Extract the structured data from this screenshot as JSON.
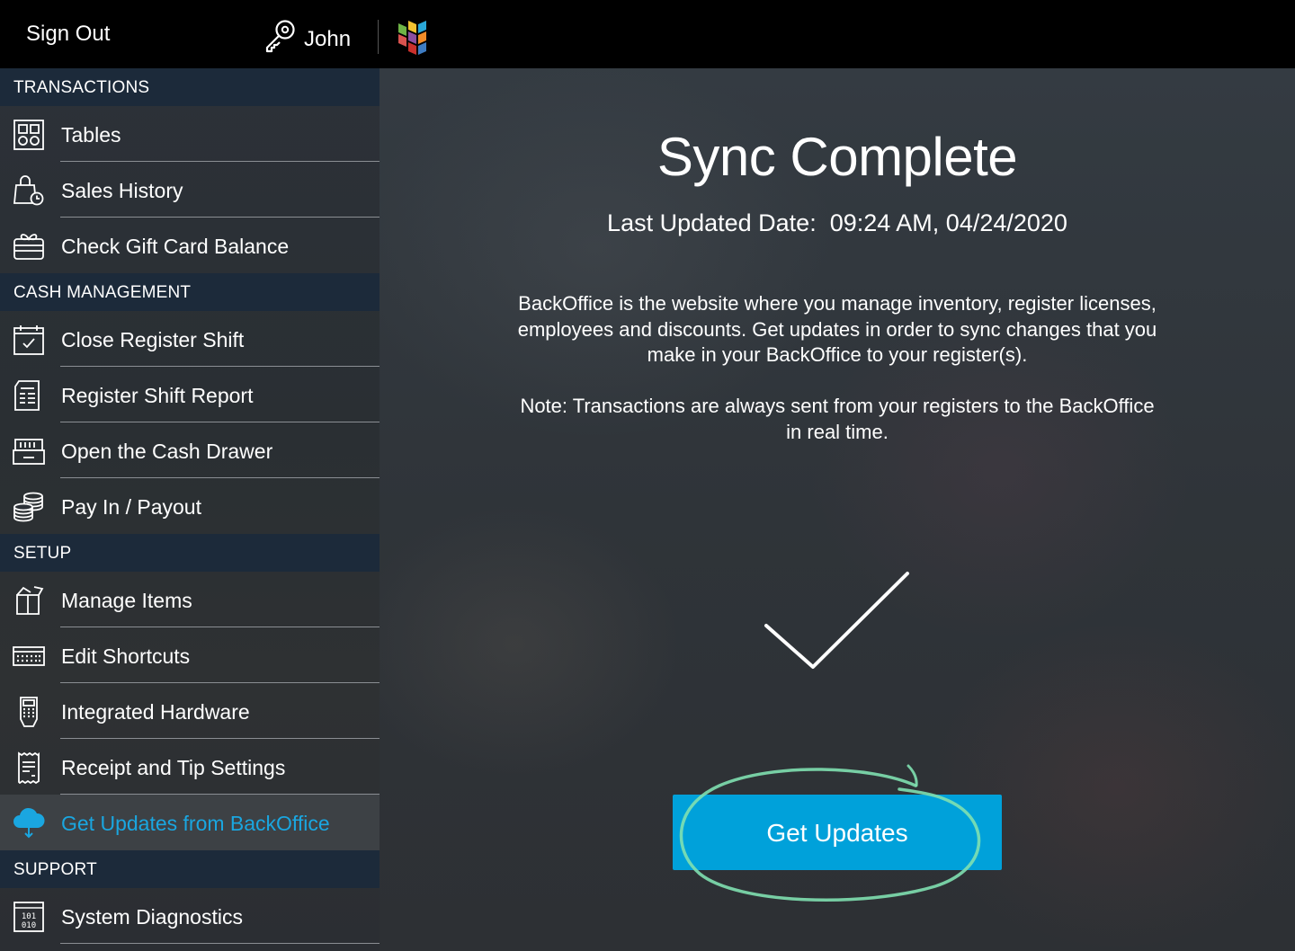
{
  "topbar": {
    "sign_out": "Sign Out",
    "user_name": "John",
    "icons": {
      "user": "key-icon",
      "logo": "brand-logo-icon"
    }
  },
  "sidebar": {
    "sections": [
      {
        "header": "TRANSACTIONS",
        "items": [
          {
            "label": "Tables",
            "icon": "tables-icon"
          },
          {
            "label": "Sales History",
            "icon": "shopping-bag-clock-icon"
          },
          {
            "label": "Check Gift Card Balance",
            "icon": "gift-card-icon"
          }
        ]
      },
      {
        "header": "CASH MANAGEMENT",
        "items": [
          {
            "label": "Close Register Shift",
            "icon": "calendar-check-icon"
          },
          {
            "label": "Register Shift Report",
            "icon": "report-icon"
          },
          {
            "label": "Open the Cash Drawer",
            "icon": "cash-drawer-icon"
          },
          {
            "label": "Pay In / Payout",
            "icon": "coins-icon"
          }
        ]
      },
      {
        "header": "SETUP",
        "items": [
          {
            "label": "Manage Items",
            "icon": "box-icon"
          },
          {
            "label": "Edit Shortcuts",
            "icon": "keyboard-icon"
          },
          {
            "label": "Integrated Hardware",
            "icon": "card-terminal-icon"
          },
          {
            "label": "Receipt and Tip Settings",
            "icon": "receipt-icon"
          },
          {
            "label": "Get Updates from BackOffice",
            "icon": "cloud-download-icon",
            "active": true
          }
        ]
      },
      {
        "header": "SUPPORT",
        "items": [
          {
            "label": "System Diagnostics",
            "icon": "binary-icon"
          }
        ]
      }
    ]
  },
  "main": {
    "title": "Sync Complete",
    "last_updated_label": "Last Updated Date:",
    "last_updated_value": "09:24 AM, 04/24/2020",
    "description": "BackOffice is the website where you manage inventory, register licenses, employees and discounts. Get updates in order to sync changes that you make in your BackOffice to your register(s).",
    "note": "Note: Transactions are always sent from your registers to the BackOffice in real time.",
    "status_icon": "checkmark-icon",
    "button_label": "Get Updates",
    "highlight_color": "#7fe0b0",
    "accent_color": "#00a1da"
  }
}
